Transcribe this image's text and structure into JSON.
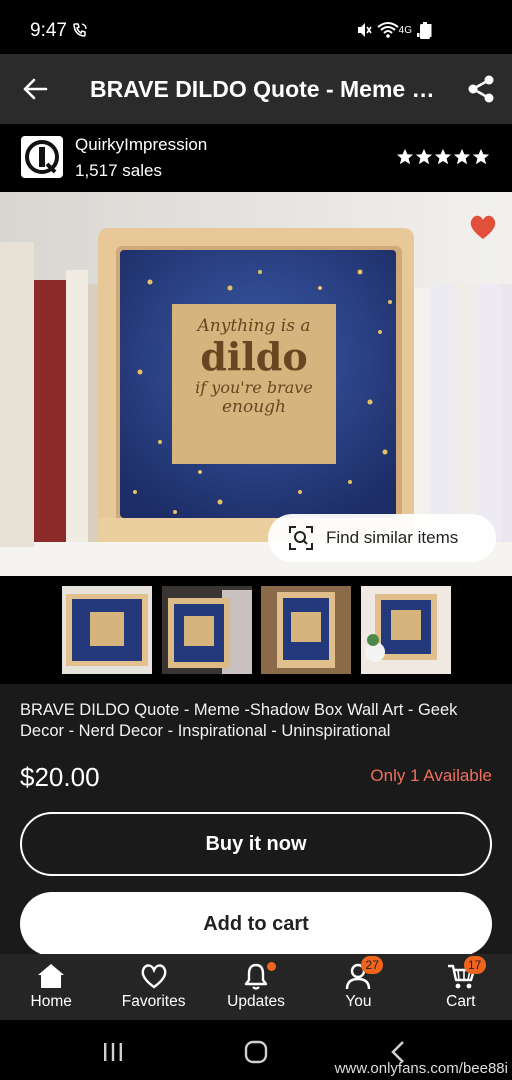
{
  "status_bar": {
    "time": "9:47",
    "network": "4G"
  },
  "app_bar": {
    "title": "BRAVE DILDO Quote - Meme -Shadow Box Wall Art"
  },
  "shop": {
    "name": "QuirkyImpression",
    "sales": "1,517 sales",
    "rating_stars": 5
  },
  "main_image": {
    "quote_line1": "Anything is a",
    "quote_line2": "dildo",
    "quote_line3": "if you're brave",
    "quote_line4": "enough",
    "find_similar_label": "Find similar items"
  },
  "listing": {
    "title": "BRAVE DILDO Quote - Meme -Shadow Box Wall Art - Geek Decor - Nerd Decor - Inspirational - Uninspirational",
    "price": "$20.00",
    "availability": "Only 1 Available",
    "buy_label": "Buy it now",
    "cart_label": "Add to cart"
  },
  "bottom_nav": {
    "home": "Home",
    "favorites": "Favorites",
    "updates": "Updates",
    "you": "You",
    "you_badge": "27",
    "cart": "Cart",
    "cart_badge": "17"
  },
  "watermark": "www.onlyfans.com/bee88i",
  "colors": {
    "accent_orange": "#f1641e",
    "availability_red": "#f06e5e",
    "heart_red": "#e0503a",
    "app_bar_bg": "#2b2b2b",
    "details_bg": "#1a1a1a",
    "nav_bg": "#252525"
  }
}
